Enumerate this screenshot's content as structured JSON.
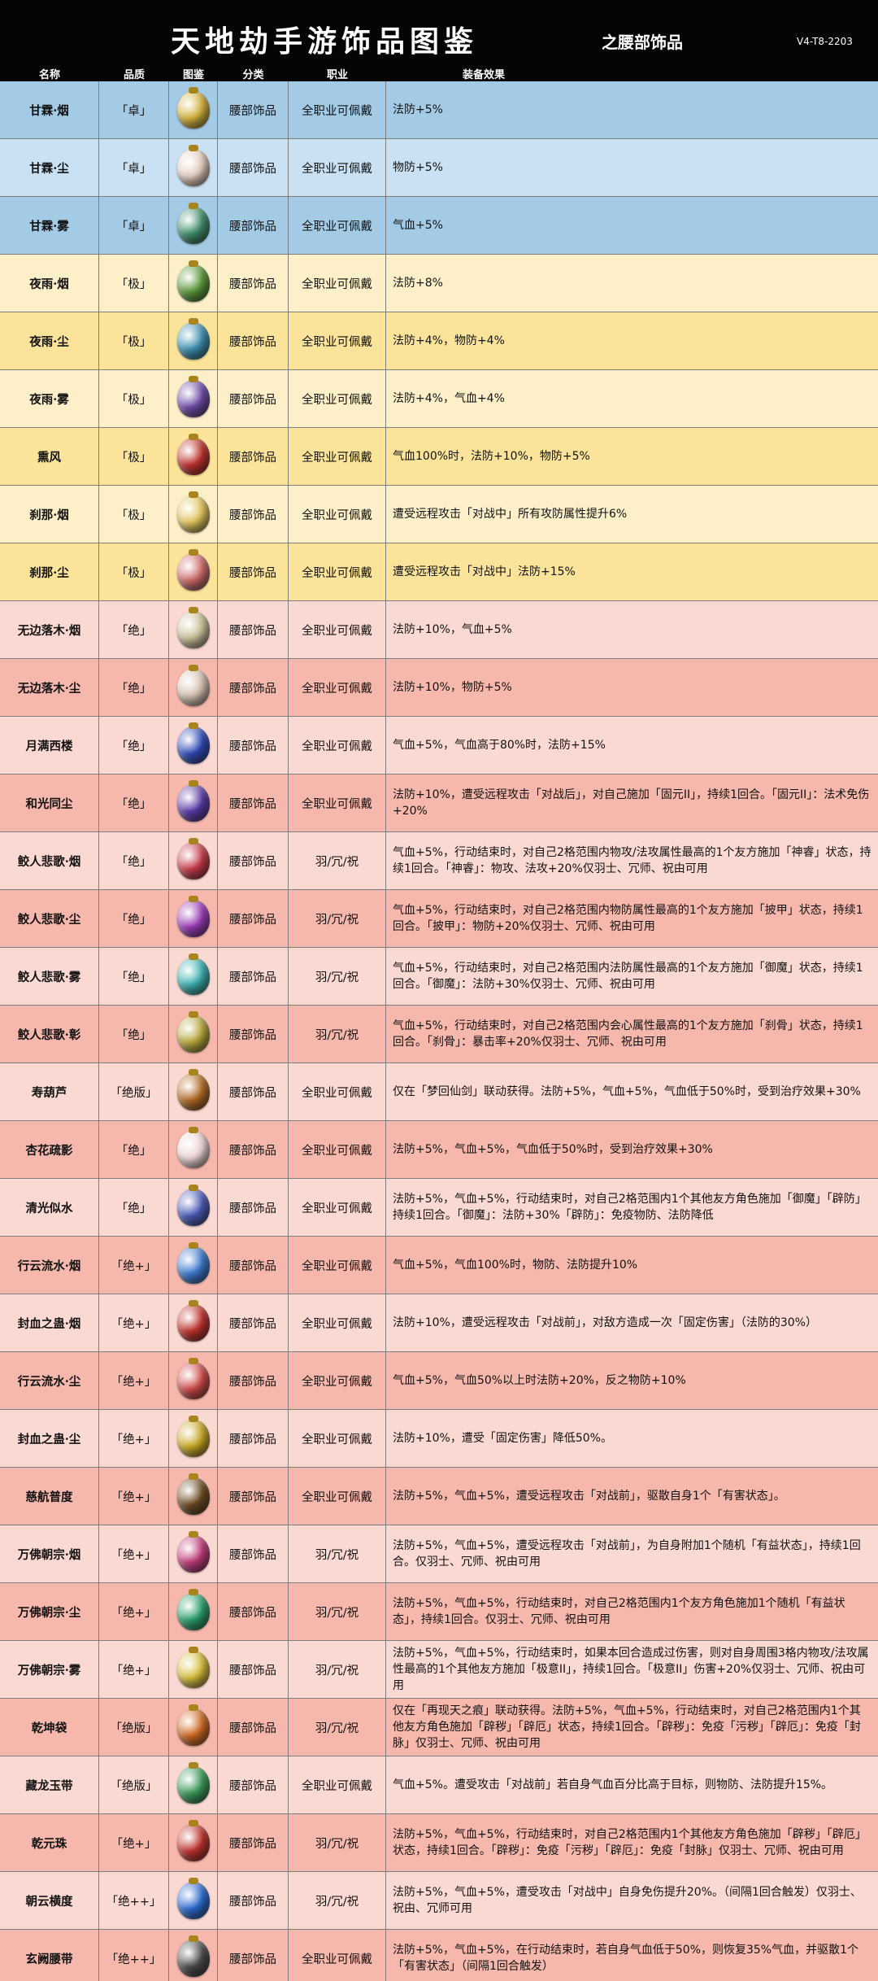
{
  "title": "天地劫手游饰品图鉴",
  "subtitle": "之腰部饰品",
  "version": "V4-T8-2203",
  "headers": {
    "name": "名称",
    "grade": "品质",
    "icon": "图鉴",
    "slot": "分类",
    "job": "职业",
    "effect": "装备效果"
  },
  "rows": [
    {
      "name": "甘霖·烟",
      "grade": "「卓」",
      "slot": "腰部饰品",
      "job": "全职业可佩戴",
      "effect": "法防+5%",
      "bg": "#a3cbe6",
      "icon_color": "#d4b33a",
      "icon": "pouch-icon"
    },
    {
      "name": "甘霖·尘",
      "grade": "「卓」",
      "slot": "腰部饰品",
      "job": "全职业可佩戴",
      "effect": "物防+5%",
      "bg": "#c9e1f2",
      "icon_color": "#e8d0c3",
      "icon": "pouch-icon"
    },
    {
      "name": "甘霖·雾",
      "grade": "「卓」",
      "slot": "腰部饰品",
      "job": "全职业可佩戴",
      "effect": "气血+5%",
      "bg": "#a3cbe6",
      "icon_color": "#3f8e6a",
      "icon": "pouch-icon"
    },
    {
      "name": "夜雨·烟",
      "grade": "「极」",
      "slot": "腰部饰品",
      "job": "全职业可佩戴",
      "effect": "法防+8%",
      "bg": "#fdf0c9",
      "icon_color": "#5a9a3a",
      "icon": "gourd-icon"
    },
    {
      "name": "夜雨·尘",
      "grade": "「极」",
      "slot": "腰部饰品",
      "job": "全职业可佩戴",
      "effect": "法防+4%，物防+4%",
      "bg": "#fbe49a",
      "icon_color": "#3c8fb0",
      "icon": "gourd-icon"
    },
    {
      "name": "夜雨·雾",
      "grade": "「极」",
      "slot": "腰部饰品",
      "job": "全职业可佩戴",
      "effect": "法防+4%，气血+4%",
      "bg": "#fdf0c9",
      "icon_color": "#6e4aa8",
      "icon": "gourd-icon"
    },
    {
      "name": "熏风",
      "grade": "「极」",
      "slot": "腰部饰品",
      "job": "全职业可佩戴",
      "effect": "气血100%时，法防+10%，物防+5%",
      "bg": "#fbe49a",
      "icon_color": "#c0302b",
      "icon": "pouch-icon"
    },
    {
      "name": "刹那·烟",
      "grade": "「极」",
      "slot": "腰部饰品",
      "job": "全职业可佩戴",
      "effect": "遭受远程攻击「对战中」所有攻防属性提升6%",
      "bg": "#fdf0c9",
      "icon_color": "#e2c55a",
      "icon": "pouch-icon"
    },
    {
      "name": "刹那·尘",
      "grade": "「极」",
      "slot": "腰部饰品",
      "job": "全职业可佩戴",
      "effect": "遭受远程攻击「对战中」法防+15%",
      "bg": "#fbe49a",
      "icon_color": "#d06a6a",
      "icon": "pouch-icon"
    },
    {
      "name": "无边落木·烟",
      "grade": "「绝」",
      "slot": "腰部饰品",
      "job": "全职业可佩戴",
      "effect": "法防+10%，气血+5%",
      "bg": "#fbd9d3",
      "icon_color": "#cfc19a",
      "icon": "jade-icon"
    },
    {
      "name": "无边落木·尘",
      "grade": "「绝」",
      "slot": "腰部饰品",
      "job": "全职业可佩戴",
      "effect": "法防+10%，物防+5%",
      "bg": "#f6b8ad",
      "icon_color": "#d8c4b2",
      "icon": "jade-icon"
    },
    {
      "name": "月满西楼",
      "grade": "「绝」",
      "slot": "腰部饰品",
      "job": "全职业可佩戴",
      "effect": "气血+5%，气血高于80%时，法防+15%",
      "bg": "#fbd9d3",
      "icon_color": "#2f49b8",
      "icon": "bottle-icon"
    },
    {
      "name": "和光同尘",
      "grade": "「绝」",
      "slot": "腰部饰品",
      "job": "全职业可佩戴",
      "effect": "法防+10%，遭受远程攻击「对战后」，对自己施加「固元II」，持续1回合。「固元II」：法术免伤+20%",
      "bg": "#f6b8ad",
      "icon_color": "#5b3aa8",
      "icon": "orb-icon"
    },
    {
      "name": "鲛人悲歌·烟",
      "grade": "「绝」",
      "slot": "腰部饰品",
      "job": "羽/冗/祝",
      "effect": "气血+5%，行动结束时，对自己2格范围内物攻/法攻属性最高的1个友方施加「神睿」状态，持续1回合。「神睿」：物攻、法攻+20%仅羽士、冗师、祝由可用",
      "bg": "#fbd9d3",
      "icon_color": "#c93a4a",
      "icon": "potion-icon"
    },
    {
      "name": "鲛人悲歌·尘",
      "grade": "「绝」",
      "slot": "腰部饰品",
      "job": "羽/冗/祝",
      "effect": "气血+5%，行动结束时，对自己2格范围内物防属性最高的1个友方施加「披甲」状态，持续1回合。「披甲」：物防+20%仅羽士、冗师、祝由可用",
      "bg": "#f6b8ad",
      "icon_color": "#9b3ab8",
      "icon": "potion-icon"
    },
    {
      "name": "鲛人悲歌·雾",
      "grade": "「绝」",
      "slot": "腰部饰品",
      "job": "羽/冗/祝",
      "effect": "气血+5%，行动结束时，对自己2格范围内法防属性最高的1个友方施加「御魔」状态，持续1回合。「御魔」：法防+30%仅羽士、冗师、祝由可用",
      "bg": "#fbd9d3",
      "icon_color": "#3ab0b0",
      "icon": "potion-icon"
    },
    {
      "name": "鲛人悲歌·彰",
      "grade": "「绝」",
      "slot": "腰部饰品",
      "job": "羽/冗/祝",
      "effect": "气血+5%，行动结束时，对自己2格范围内会心属性最高的1个友方施加「刹骨」状态，持续1回合。「刹骨」：暴击率+20%仅羽士、冗师、祝由可用",
      "bg": "#f6b8ad",
      "icon_color": "#b8a83a",
      "icon": "potion-icon"
    },
    {
      "name": "寿葫芦",
      "grade": "「绝版」",
      "slot": "腰部饰品",
      "job": "全职业可佩戴",
      "effect": "仅在「梦回仙剑」联动获得。法防+5%，气血+5%，气血低于50%时，受到治疗效果+30%",
      "bg": "#fbd9d3",
      "icon_color": "#b36a22",
      "icon": "gourd-icon"
    },
    {
      "name": "杏花疏影",
      "grade": "「绝」",
      "slot": "腰部饰品",
      "job": "全职业可佩戴",
      "effect": "法防+5%，气血+5%，气血低于50%时，受到治疗效果+30%",
      "bg": "#f6b8ad",
      "icon_color": "#f0d6d6",
      "icon": "bottle-icon"
    },
    {
      "name": "清光似水",
      "grade": "「绝」",
      "slot": "腰部饰品",
      "job": "全职业可佩戴",
      "effect": "法防+5%，气血+5%，行动结束时，对自己2格范围内1个其他友方角色施加「御魔」「辟防」持续1回合。「御魔」：法防+30%「辟防」：免疫物防、法防降低",
      "bg": "#fbd9d3",
      "icon_color": "#4a5ab8",
      "icon": "fan-icon"
    },
    {
      "name": "行云流水·烟",
      "grade": "「绝+」",
      "slot": "腰部饰品",
      "job": "全职业可佩戴",
      "effect": "气血+5%，气血100%时，物防、法防提升10%",
      "bg": "#f6b8ad",
      "icon_color": "#3a7ad0",
      "icon": "potion-icon"
    },
    {
      "name": "封血之蛊·烟",
      "grade": "「绝+」",
      "slot": "腰部饰品",
      "job": "全职业可佩戴",
      "effect": "法防+10%，遭受远程攻击「对战前」，对敌方造成一次「固定伤害」（法防的30%）",
      "bg": "#fbd9d3",
      "icon_color": "#c0302b",
      "icon": "pot-icon"
    },
    {
      "name": "行云流水·尘",
      "grade": "「绝+」",
      "slot": "腰部饰品",
      "job": "全职业可佩戴",
      "effect": "气血+5%，气血50%以上时法防+20%，反之物防+10%",
      "bg": "#f6b8ad",
      "icon_color": "#d04a4a",
      "icon": "potion-icon"
    },
    {
      "name": "封血之蛊·尘",
      "grade": "「绝+」",
      "slot": "腰部饰品",
      "job": "全职业可佩戴",
      "effect": "法防+10%，遭受「固定伤害」降低50%。",
      "bg": "#fbd9d3",
      "icon_color": "#c9a822",
      "icon": "pot-icon"
    },
    {
      "name": "慈航普度",
      "grade": "「绝+」",
      "slot": "腰部饰品",
      "job": "全职业可佩戴",
      "effect": "法防+5%，气血+5%，遭受远程攻击「对战前」，驱散自身1个「有害状态」。",
      "bg": "#f6b8ad",
      "icon_color": "#6b4a22",
      "icon": "pendant-icon"
    },
    {
      "name": "万佛朝宗·烟",
      "grade": "「绝+」",
      "slot": "腰部饰品",
      "job": "羽/冗/祝",
      "effect": "法防+5%，气血+5%，遭受远程攻击「对战前」，为自身附加1个随机「有益状态」，持续1回合。仅羽士、冗师、祝由可用",
      "bg": "#fbd9d3",
      "icon_color": "#c03a7a",
      "icon": "pouch-icon"
    },
    {
      "name": "万佛朝宗·尘",
      "grade": "「绝+」",
      "slot": "腰部饰品",
      "job": "羽/冗/祝",
      "effect": "法防+5%，气血+5%，行动结束时，对自己2格范围内1个友方角色施加1个随机「有益状态」，持续1回合。仅羽士、冗师、祝由可用",
      "bg": "#f6b8ad",
      "icon_color": "#2aa06a",
      "icon": "pouch-icon"
    },
    {
      "name": "万佛朝宗·雾",
      "grade": "「绝+」",
      "slot": "腰部饰品",
      "job": "羽/冗/祝",
      "effect": "法防+5%，气血+5%，行动结束时，如果本回合造成过伤害，则对自身周围3格内物攻/法攻属性最高的1个其他友方施加「极意II」，持续1回合。「极意II」伤害+20%仅羽士、冗师、祝由可用",
      "bg": "#fbd9d3",
      "icon_color": "#d8c03a",
      "icon": "pouch-icon"
    },
    {
      "name": "乾坤袋",
      "grade": "「绝版」",
      "slot": "腰部饰品",
      "job": "羽/冗/祝",
      "effect": "仅在「再现天之痕」联动获得。法防+5%，气血+5%，行动结束时，对自己2格范围内1个其他友方角色施加「辟秽」「辟厄」状态，持续1回合。「辟秽」：免疫「污秽」「辟厄」：免疫「封脉」仅羽士、冗师、祝由可用",
      "bg": "#f6b8ad",
      "icon_color": "#d06a22",
      "icon": "bag-icon"
    },
    {
      "name": "藏龙玉带",
      "grade": "「绝版」",
      "slot": "腰部饰品",
      "job": "全职业可佩戴",
      "effect": "气血+5%。遭受攻击「对战前」若自身气血百分比高于目标，则物防、法防提升15%。",
      "bg": "#fbd9d3",
      "icon_color": "#3a9a5a",
      "icon": "belt-icon"
    },
    {
      "name": "乾元珠",
      "grade": "「绝+」",
      "slot": "腰部饰品",
      "job": "羽/冗/祝",
      "effect": "法防+5%，气血+5%，行动结束时，对自己2格范围内1个其他友方角色施加「辟秽」「辟厄」状态，持续1回合。「辟秽」：免疫「污秽」「辟厄」：免疫「封脉」仅羽士、冗师、祝由可用",
      "bg": "#f6b8ad",
      "icon_color": "#c0302b",
      "icon": "orb-icon"
    },
    {
      "name": "朝云横度",
      "grade": "「绝++」",
      "slot": "腰部饰品",
      "job": "羽/冗/祝",
      "effect": "法防+5%，气血+5%，遭受攻击「对战中」自身免伤提升20%。（间隔1回合触发）仅羽士、祝由、冗师可用",
      "bg": "#fbd9d3",
      "icon_color": "#2a6ad0",
      "icon": "pouch-icon"
    },
    {
      "name": "玄阙腰带",
      "grade": "「绝++」",
      "slot": "腰部饰品",
      "job": "全职业可佩戴",
      "effect": "法防+5%，气血+5%，在行动结束时，若自身气血低于50%，则恢复35%气血，并驱散1个「有害状态」（间隔1回合触发）",
      "bg": "#f6b8ad",
      "icon_color": "#4a4a4a",
      "icon": "belt-icon"
    }
  ]
}
